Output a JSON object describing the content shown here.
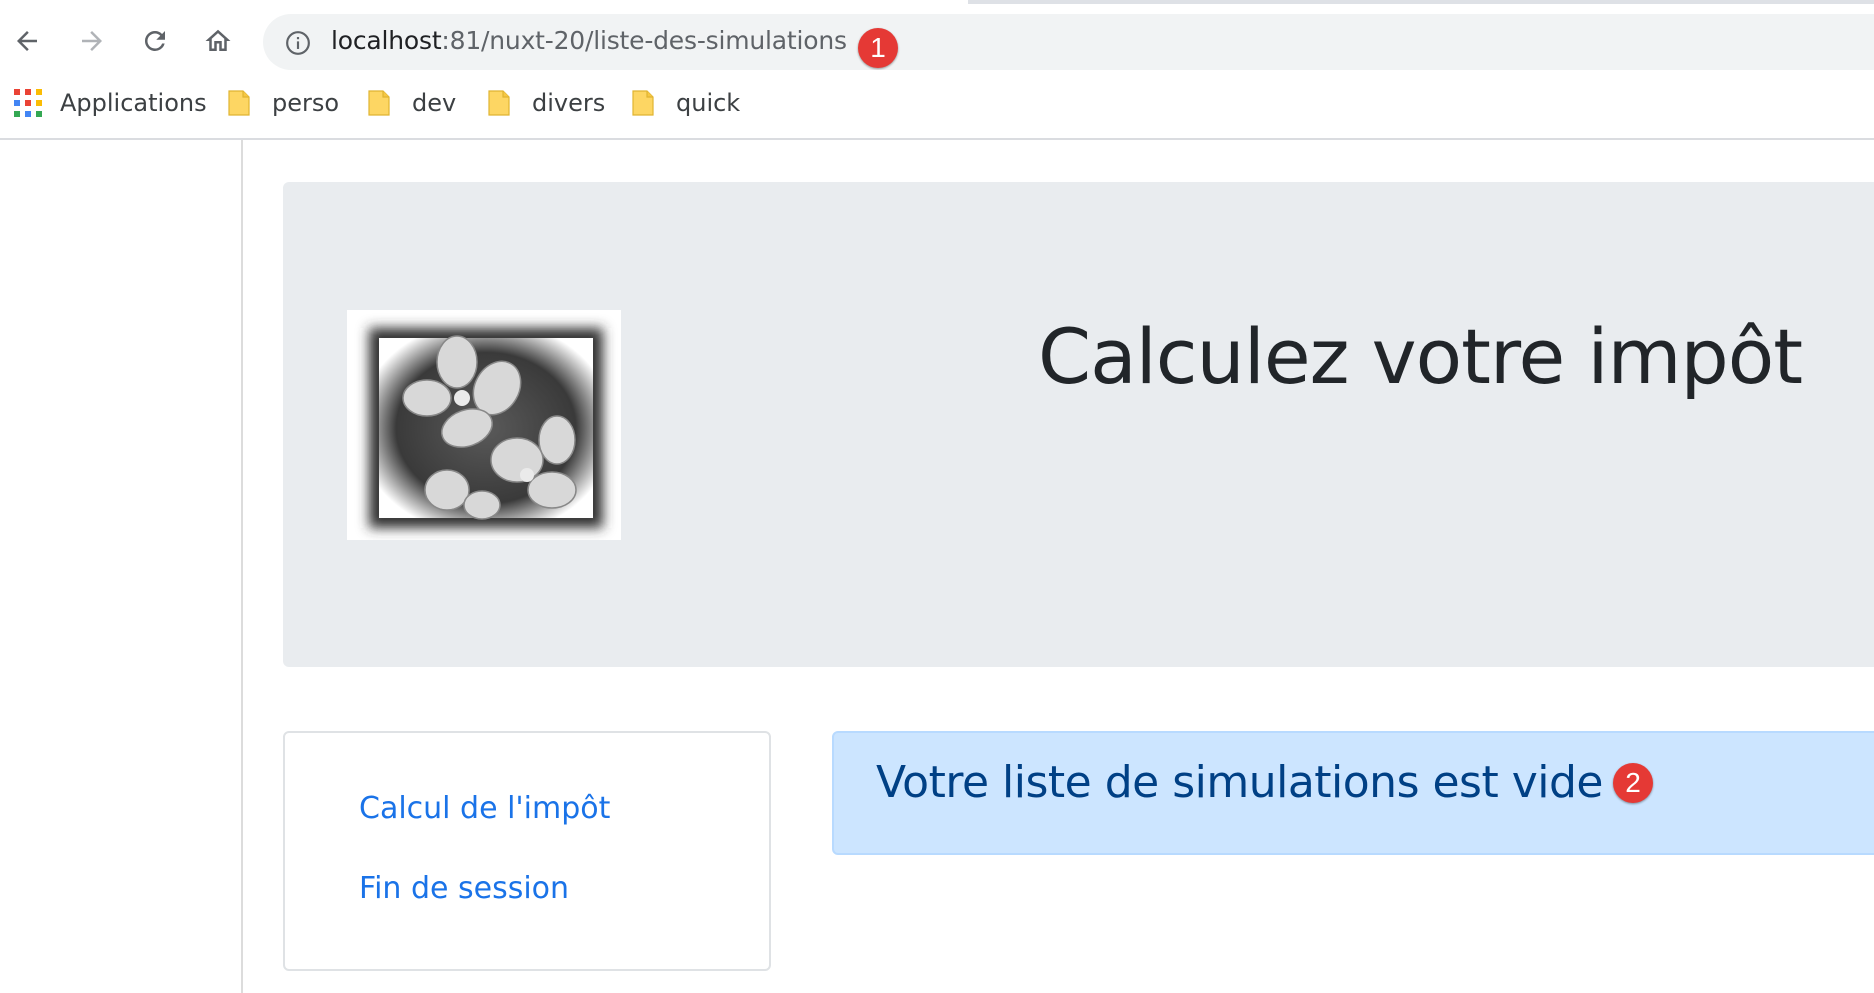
{
  "browser": {
    "address_bar": {
      "host": "localhost",
      "rest": ":81/nuxt-20/liste-des-simulations"
    },
    "bookmarks": [
      {
        "label": "Applications"
      },
      {
        "label": "perso"
      },
      {
        "label": "dev"
      },
      {
        "label": "divers"
      },
      {
        "label": "quick"
      }
    ],
    "icons": {
      "back": "arrow-left-icon",
      "forward": "arrow-right-icon",
      "reload": "reload-icon",
      "home": "home-icon",
      "info": "info-icon"
    }
  },
  "markers": {
    "first": "1",
    "second": "2"
  },
  "page": {
    "header_title": "Calculez votre impôt",
    "menu": [
      {
        "label": "Calcul de l'impôt"
      },
      {
        "label": "Fin de session"
      }
    ],
    "alert_message": "Votre liste de simulations est vide"
  },
  "colors": {
    "marker": "#e53935",
    "link": "#1a73e8",
    "alert_bg": "#cce5ff",
    "alert_text": "#004085",
    "jumbotron_bg": "#e9ecef",
    "folder": "#fdd663"
  }
}
